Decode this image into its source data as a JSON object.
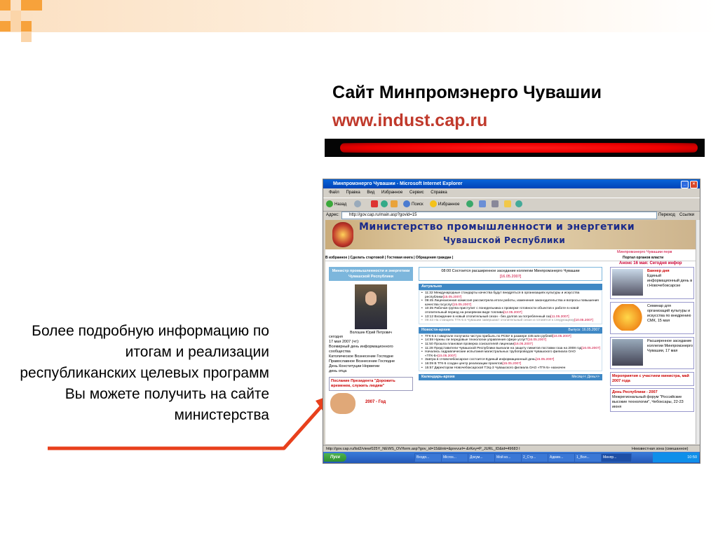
{
  "slide": {
    "title": "Сайт Минпромэнерго Чувашии",
    "url": "www.indust.cap.ru",
    "info_text": "Более подробную информацию по итогам и реализации республиканских целевых программ Вы можете получить на сайте министерства",
    "colors": {
      "accent_orange": "#f7a23b",
      "url_red": "#c0392b",
      "arrow_red": "#e8401c"
    }
  },
  "browser": {
    "title": "Минпромэнерго Чувашии - Microsoft Internet Explorer",
    "menu": [
      "Файл",
      "Правка",
      "Вид",
      "Избранное",
      "Сервис",
      "Справка"
    ],
    "toolbar": {
      "back": "Назад",
      "search": "Поиск",
      "favorites": "Избранное"
    },
    "address_label": "Адрес:",
    "address_value": "http://gov.cap.ru/main.asp?govid=15",
    "go_label": "Переход",
    "links_label": "Ссылки",
    "status_url": "http://gov.cap.ru/list2/view/025Y_NEWS_OV/form.asp?gov_id=15&link=&prevurl=-&rKey=P_JURL_ID&id=49683 l",
    "status_zone": "Неизвестная зона (смешанное)"
  },
  "site": {
    "banner_line1": "Министерство промышленности и энергетики",
    "banner_line2": "Чувашской Республики",
    "ticker": "Минпромэнерго Чувашии перв",
    "top_links": "В избранное | Сделать стартовой | Гостевая книга | Обращения граждан |",
    "top_links_right": "Портал органов власти",
    "anons": "Анонс 16 мая: Сегодня инфор",
    "left": {
      "header": "Министр промышленности и энергетики Чувашской Республики",
      "minister": "Волошин Юрий Петрович",
      "lines": [
        "сегодня",
        "17 мая 2007 (чт):",
        "Всемирный день информационного сообщества",
        "Католическое Вознесение Господне",
        "Православное Вознесение Господне",
        "День Конституции Норвегии",
        "день отца"
      ],
      "poslanie": "Послание Президента \"Дорожить временем, служить людям\"",
      "year_label": "2007 - Год"
    },
    "main": {
      "event_text": "08:00 Состоится расширенное заседание коллегии Минпромэнерго Чувашии",
      "event_date": "[16.05.2007]",
      "section1": "Актуально",
      "actual": [
        {
          "text": "11:32 Международные стандарты качества будут внедряться в организациях культуры и искусства республики",
          "date": "[15.05.2007]",
          "gray": false
        },
        {
          "text": "09:45 Лицензионная комиссия рассмотрела итоги работы, изменения законодательства и вопросы повышения качества госуслуг",
          "date": "[15.05.2007]",
          "gray": false
        },
        {
          "text": "10:35 Рабочая группа приступит с понедельника к проверке готовности объектов к работе в новой отопительный период на резервном виде топлива",
          "date": "[12.05.2007]",
          "gray": false
        },
        {
          "text": "13:12 Вхождение в новый отопительный сезон - без долгов за потребленный газ",
          "date": "[11.05.2007]",
          "gray": false
        },
        {
          "text": "09:43 На станциях ТГК-5 в Чувашии завершают отопительный сезон и готовятся к следующему",
          "date": "[10.05.2007]",
          "gray": true
        }
      ],
      "section2": "Новости-архив",
      "section2_right": "Выпуск: 16.05.2007",
      "archive": [
        {
          "text": "ТГК-5 в I квартале получила чистую прибыль по РСБУ в размере 445 млн рублей",
          "date": "[16.05.2007]"
        },
        {
          "text": "14:59 Нужны ли передовые технологии управления сфере услуг?",
          "date": "[16.05.2007]"
        },
        {
          "text": "11:50 Прошла плановая проверка соискателей лицензии",
          "date": "[16.05.2007]"
        },
        {
          "text": "11:28 Представители Чувашской Республики выехали на защиту лимитов поставки газа на 2008 год",
          "date": "[16.05.2007]"
        },
        {
          "text": "Начались гидравлические испытания магистральных трубопроводов Чувашского филиала ОАО «ТГК-5»",
          "date": "[15.05.2007]"
        },
        {
          "text": "Завтра в г.Новочебоксарске состоится Единый информационный день",
          "date": "[15.05.2007]"
        },
        {
          "text": "16:09 В ТГК-5 создан центр реализации проектов",
          "date": "[15.05.2007]"
        },
        {
          "text": "15:57 Директором Новочебоксарской ТЭЦ-3 Чувашского филиала ОАО «ТГК-5» назначен",
          "date": ""
        }
      ],
      "section3": "Календарь-архив",
      "section3_right": "Месяц<< День>>"
    },
    "right": {
      "box1_title": "Баннер дня",
      "box1_text": "Единый информационный день в г.Новочебоксарске",
      "box2_text": "Семинар для организаций культуры и искусства по внедрению СМК, 15 мая",
      "box3_text": "Расширенное заседание коллегии Минпромэнерго Чувашии, 17 мая",
      "note1": "Мероприятия с участием министра, май 2007 года",
      "box4_title": "День Республики - 2007",
      "box4_text": "Межрегиональный форум \"Российские высокие технологии\", Чебоксары, 22-23 июня"
    }
  },
  "taskbar": {
    "start": "Пуск",
    "tasks": [
      "Входя...",
      "Micros...",
      "Докум...",
      "Мой ко...",
      "2_Стр...",
      "Админ...",
      "1_Вол...",
      "Минпр..."
    ],
    "clock": "10:50"
  }
}
